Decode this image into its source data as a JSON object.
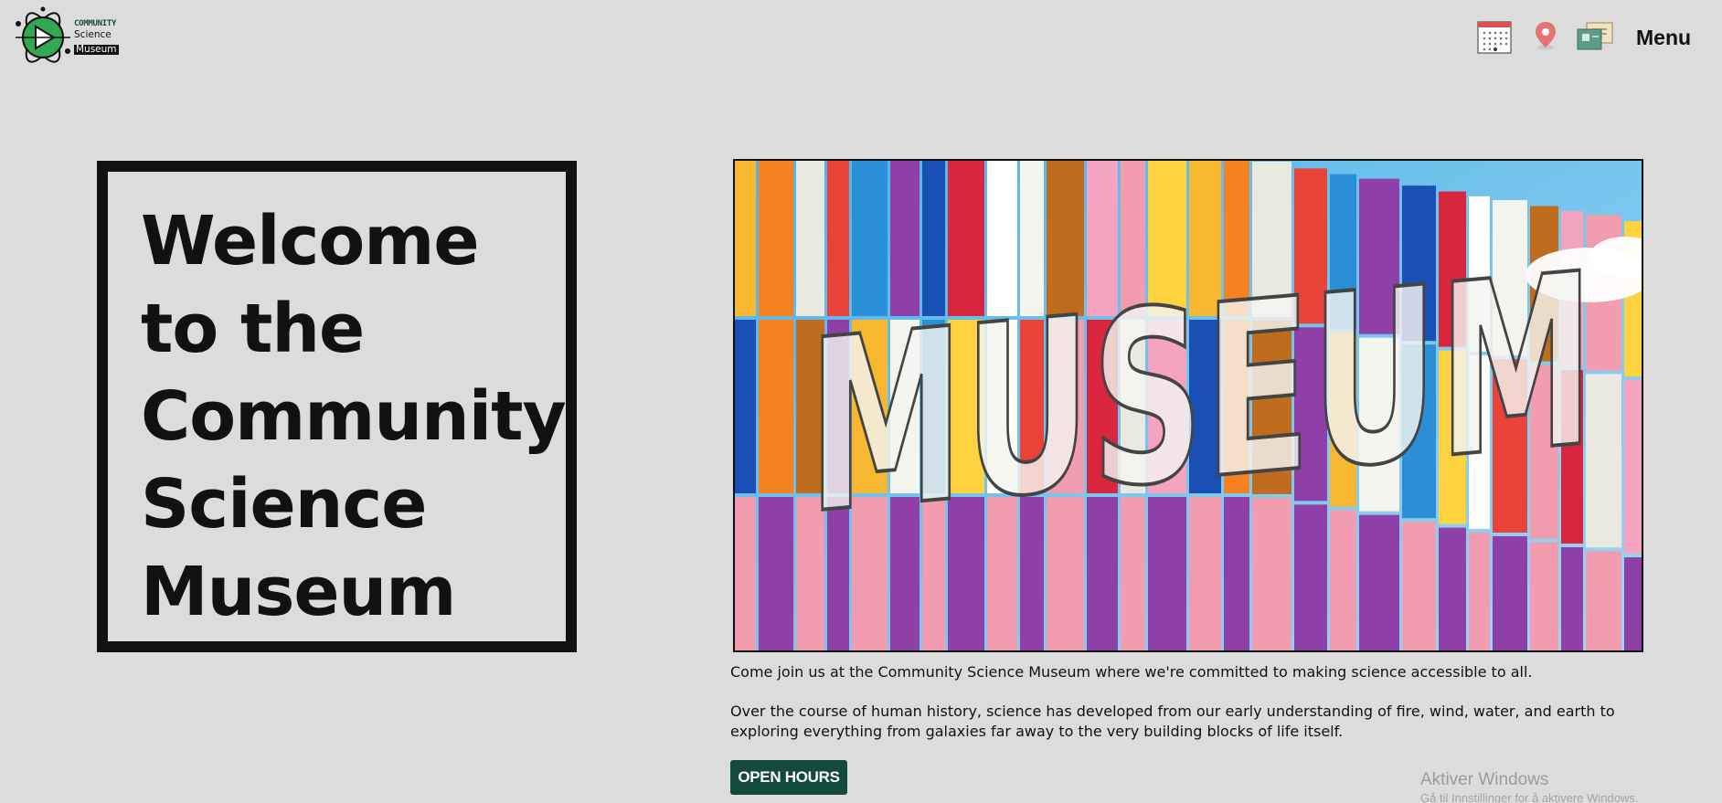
{
  "logo": {
    "line1": "COMMUNITY",
    "line2": "Science",
    "line3": "Museum",
    "icon": "atom-play-icon",
    "accent": "#33a853"
  },
  "nav": {
    "icons": [
      "calendar-icon",
      "location-pin-icon",
      "tickets-icon"
    ],
    "menu_label": "Menu"
  },
  "hero": {
    "title_lines": [
      "Welcome",
      "to the",
      "Community",
      "Science",
      "Museum"
    ],
    "image_text": "MUSEUM"
  },
  "content": {
    "intro": "Come join us at the Community Science Museum where we're committed to making science accessible to all.",
    "body": "Over the course of human history, science has developed from our early understanding of fire, wind, water, and earth to exploring everything from galaxies far away to the very building blocks of life itself.",
    "button_label": "OPEN HOURS",
    "button_color": "#134a3d"
  },
  "watermark": {
    "line1": "Aktiver Windows",
    "line2": "Gå til Innstillinger for å aktivere Windows."
  }
}
